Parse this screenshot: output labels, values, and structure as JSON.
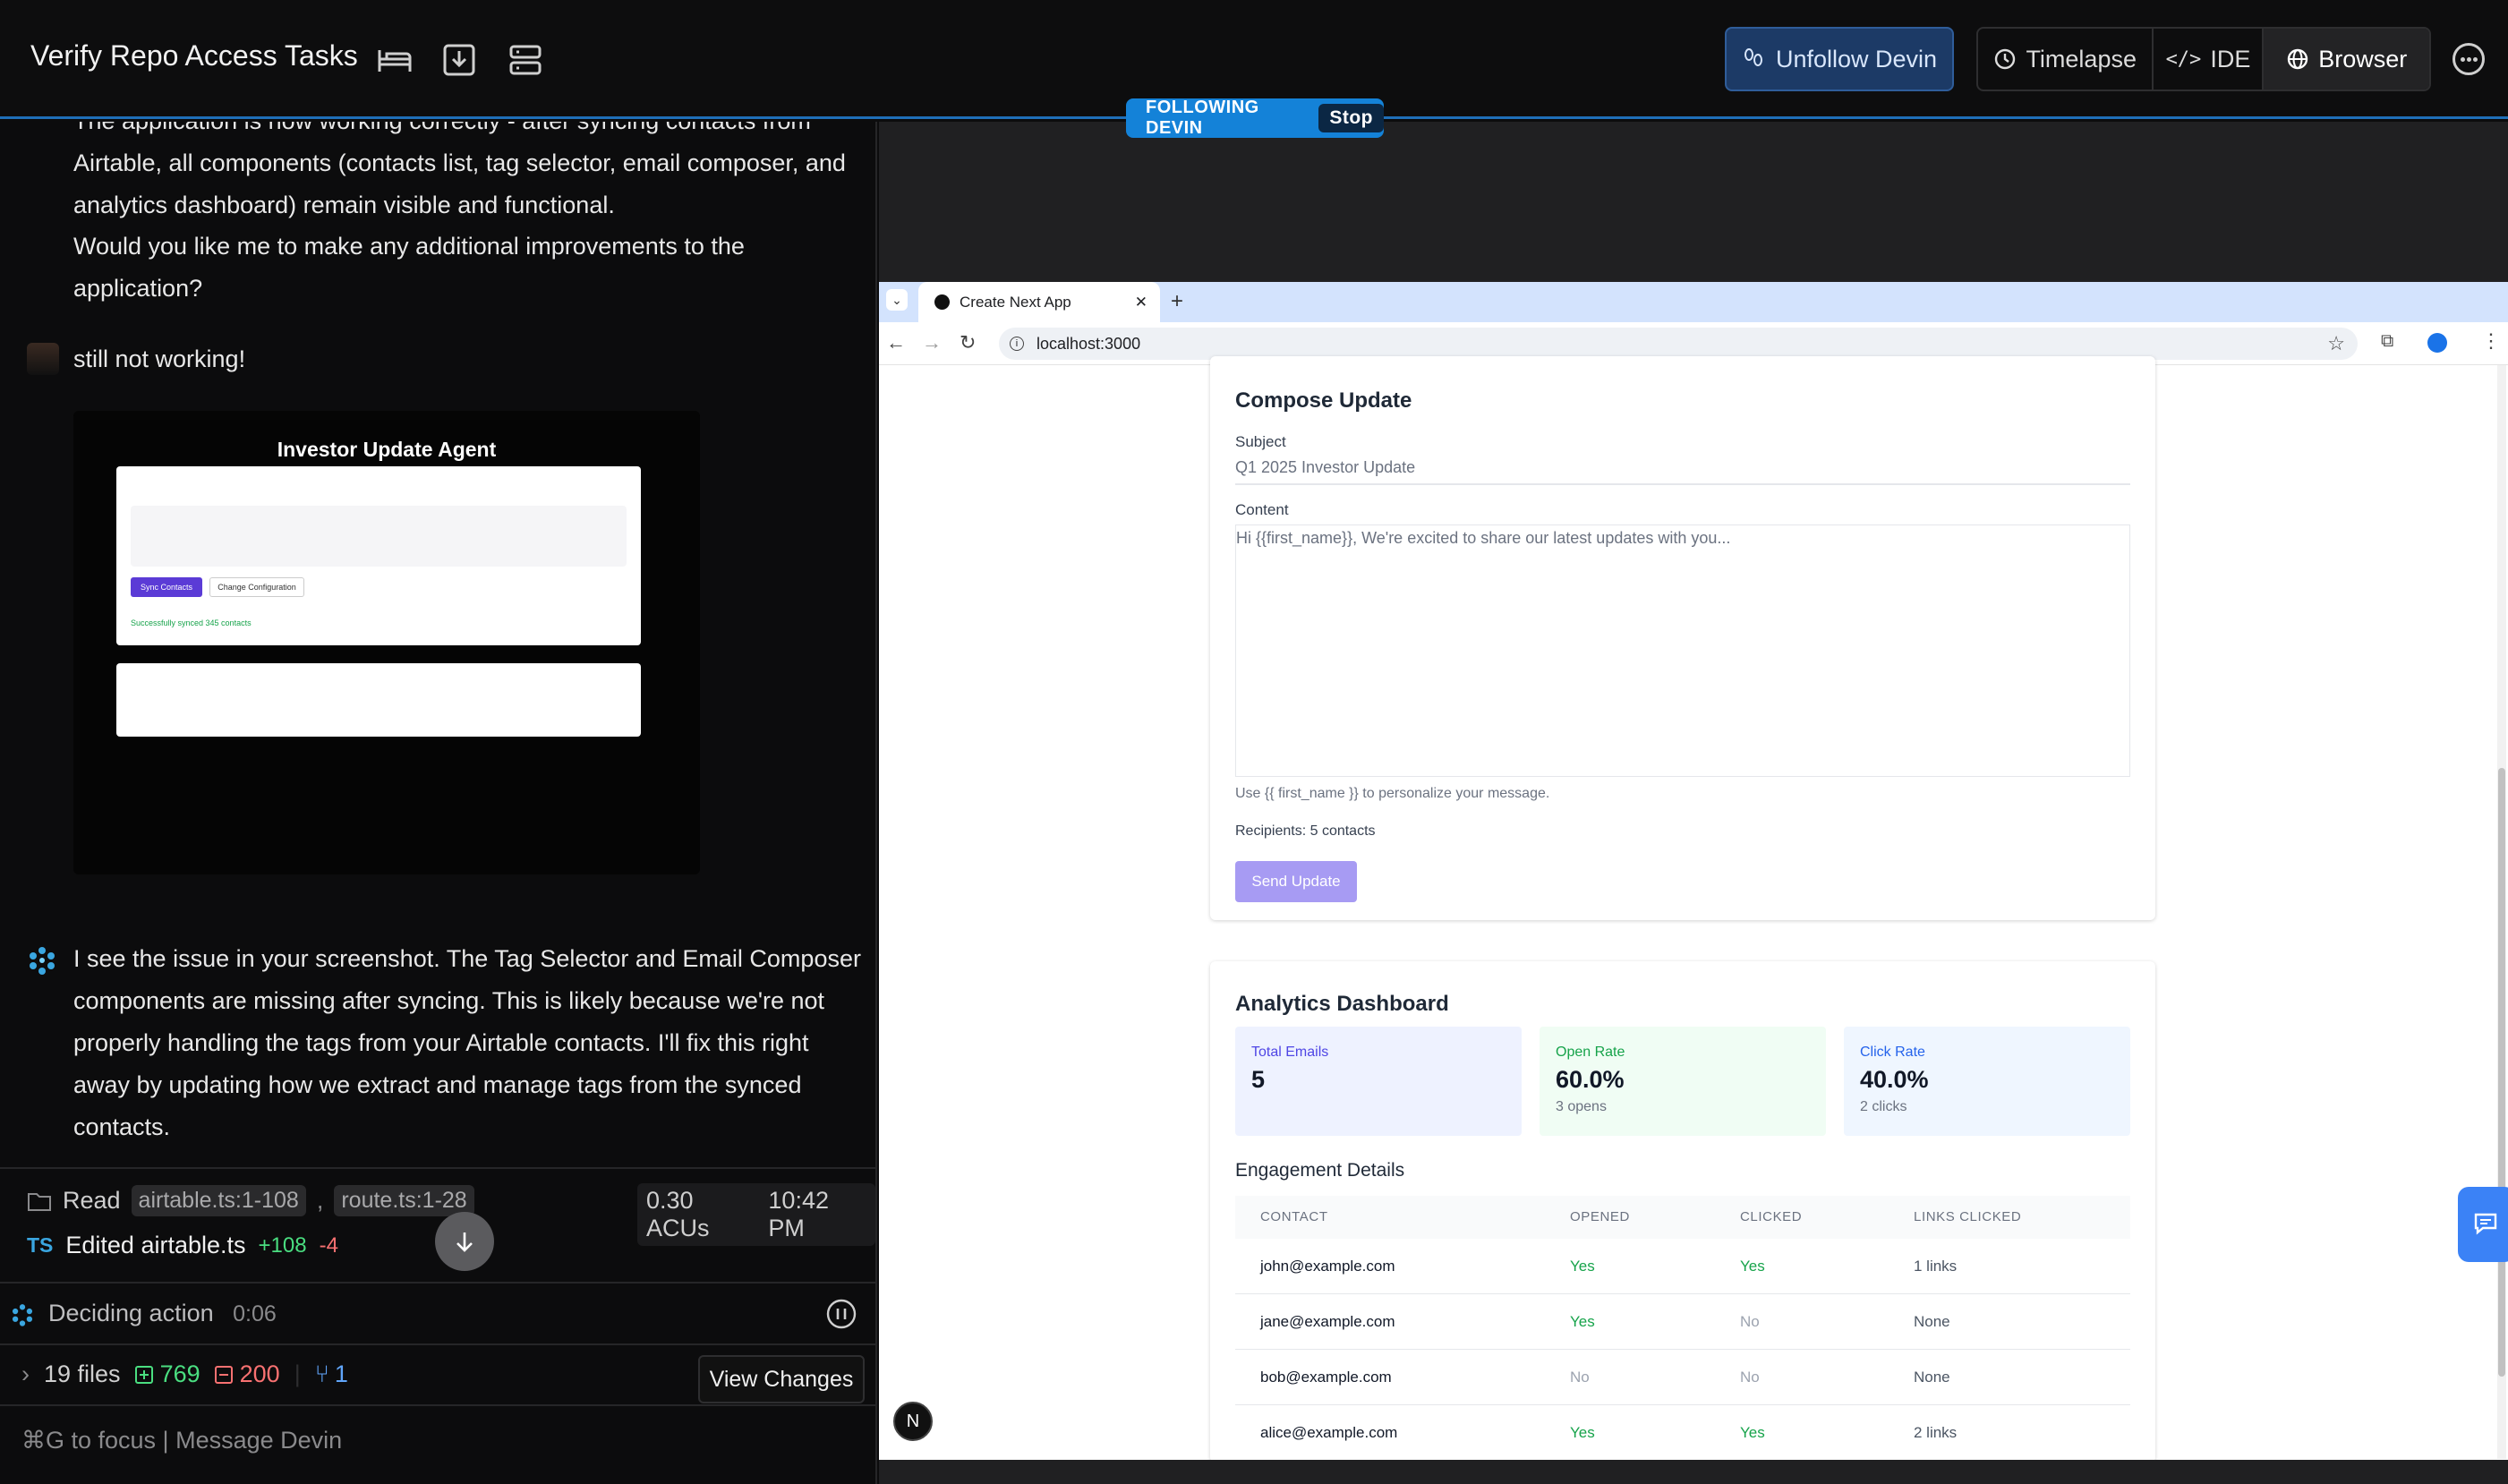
{
  "header": {
    "title": "Verify Repo Access Tasks",
    "unfollow_label": "Unfollow Devin",
    "timelapse_label": "Timelapse",
    "ide_label": "IDE",
    "browser_label": "Browser",
    "following_label": "FOLLOWING DEVIN",
    "stop_label": "Stop"
  },
  "chat": {
    "msg1": "The application is now working correctly - after syncing contacts from Airtable, all components (contacts list, tag selector, email composer, and analytics dashboard) remain visible and functional.",
    "msg1b": "Would you like me to make any additional improvements to the application?",
    "user_msg": "still not working!",
    "shot_title": "Investor Update Agent",
    "shot_sync": "Sync Contacts",
    "shot_change": "Change Configuration",
    "shot_success": "Successfully synced 345 contacts",
    "devin_msg": "I see the issue in your screenshot. The Tag Selector and Email Composer components are missing after syncing. This is likely because we're not properly handling the tags from your Airtable contacts. I'll fix this right away by updating how we extract and manage tags from the synced contacts.",
    "read_label": "Read",
    "read_file1": "airtable.ts:1-108",
    "read_file2": "route.ts:1-28",
    "acus": "0.30 ACUs",
    "time": "10:42 PM",
    "edited_lang": "TS",
    "edited_label": "Edited airtable.ts",
    "edited_add": "+108",
    "edited_del": "-4",
    "deciding": "Deciding action",
    "deciding_time": "0:06",
    "files": "19 files",
    "additions": "769",
    "deletions": "200",
    "prs": "1",
    "view_changes": "View Changes",
    "input_placeholder": "⌘G to focus | Message Devin"
  },
  "browser": {
    "tab_title": "Create Next App",
    "url": "localhost:3000"
  },
  "compose": {
    "title": "Compose Update",
    "subject_label": "Subject",
    "subject_placeholder": "Q1 2025 Investor Update",
    "content_label": "Content",
    "content_placeholder": "Hi {{first_name}},  We're excited to share our latest updates with you...",
    "hint": "Use {{ first_name }} to personalize your message.",
    "recipients": "Recipients: 5 contacts",
    "send_label": "Send Update"
  },
  "analytics": {
    "title": "Analytics Dashboard",
    "stats": [
      {
        "label": "Total Emails",
        "value": "5",
        "sub": "",
        "color": "#4f46e5",
        "bg": "#eef2ff"
      },
      {
        "label": "Open Rate",
        "value": "60.0%",
        "sub": "3 opens",
        "color": "#16a34a",
        "bg": "#f0fdf4"
      },
      {
        "label": "Click Rate",
        "value": "40.0%",
        "sub": "2 clicks",
        "color": "#2563eb",
        "bg": "#eff6ff"
      }
    ],
    "engagement_title": "Engagement Details",
    "columns": [
      "CONTACT",
      "OPENED",
      "CLICKED",
      "LINKS CLICKED"
    ],
    "rows": [
      {
        "contact": "john@example.com",
        "opened": "Yes",
        "clicked": "Yes",
        "links": "1 links"
      },
      {
        "contact": "jane@example.com",
        "opened": "Yes",
        "clicked": "No",
        "links": "None"
      },
      {
        "contact": "bob@example.com",
        "opened": "No",
        "clicked": "No",
        "links": "None"
      },
      {
        "contact": "alice@example.com",
        "opened": "Yes",
        "clicked": "Yes",
        "links": "2 links"
      }
    ]
  },
  "badge_letter": "N"
}
